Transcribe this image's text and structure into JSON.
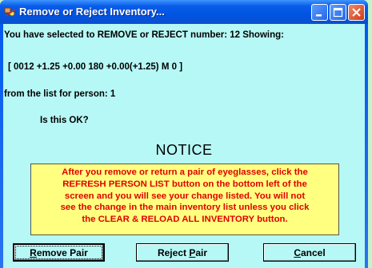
{
  "window": {
    "title": "Remove or Reject Inventory...",
    "icon": "eyeglasses-app-icon",
    "controls": [
      "minimize",
      "maximize",
      "close"
    ]
  },
  "body": {
    "line1": "You have selected to REMOVE or REJECT number:  12 Showing:",
    "line2": "[ 0012 +1.25 +0.00 180 +0.00(+1.25)    M  0 ]",
    "line3": "from the list for person: 1",
    "line4": "Is this OK?"
  },
  "notice": {
    "heading": "NOTICE",
    "lines": [
      "After you remove or return a pair of eyeglasses, click the",
      "REFRESH PERSON LIST button on the bottom left of the",
      "screen and you will see your change listed. You will not",
      "see the change in the main inventory list unless you click",
      "the CLEAR & RELOAD ALL INVENTORY button."
    ]
  },
  "buttons": {
    "remove": {
      "prefix": "",
      "underlined": "R",
      "rest": "emove Pair"
    },
    "reject": {
      "prefix": "Reject ",
      "underlined": "P",
      "rest": "air"
    },
    "cancel": {
      "prefix": "",
      "underlined": "C",
      "rest": "ancel"
    }
  },
  "colors": {
    "client_bg": "#b6f8f6",
    "notice_bg": "#ffff80",
    "notice_text": "#e00000",
    "titlebar": "#0054e3",
    "desktop": "#c6f3c8"
  }
}
